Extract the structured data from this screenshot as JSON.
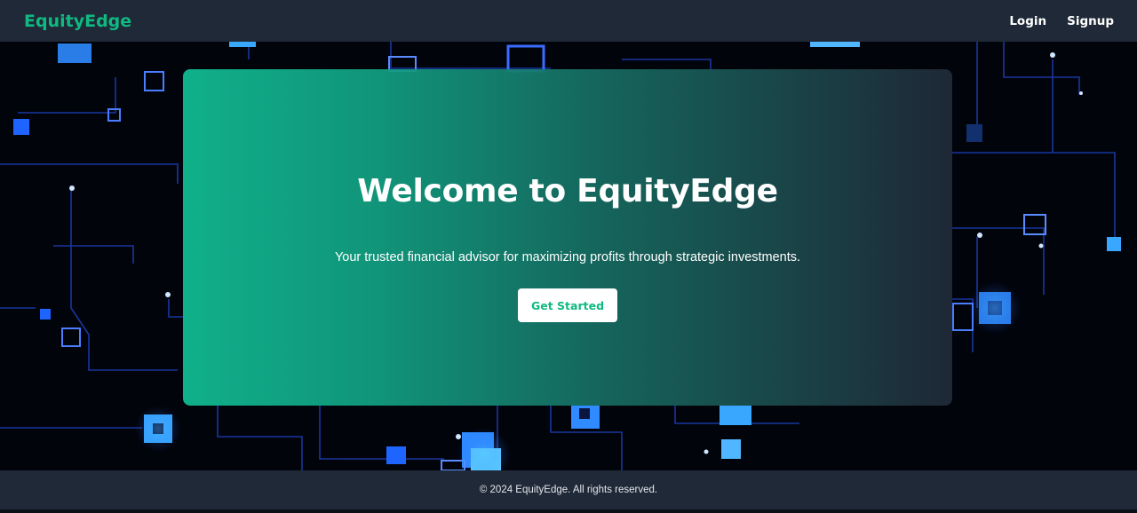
{
  "navbar": {
    "brand": "EquityEdge",
    "links": [
      {
        "label": "Login"
      },
      {
        "label": "Signup"
      }
    ]
  },
  "hero": {
    "title": "Welcome to EquityEdge",
    "subtitle": "Your trusted financial advisor for maximizing profits through strategic investments.",
    "cta_label": "Get Started",
    "background": "circuit-board-image"
  },
  "footer": {
    "text": "© 2024 EquityEdge. All rights reserved."
  },
  "colors": {
    "accent": "#10b981",
    "navbar_bg": "#1f2937",
    "card_gradient_start": "#10b991",
    "card_gradient_end": "#1f2937",
    "text_light": "#ffffff"
  }
}
